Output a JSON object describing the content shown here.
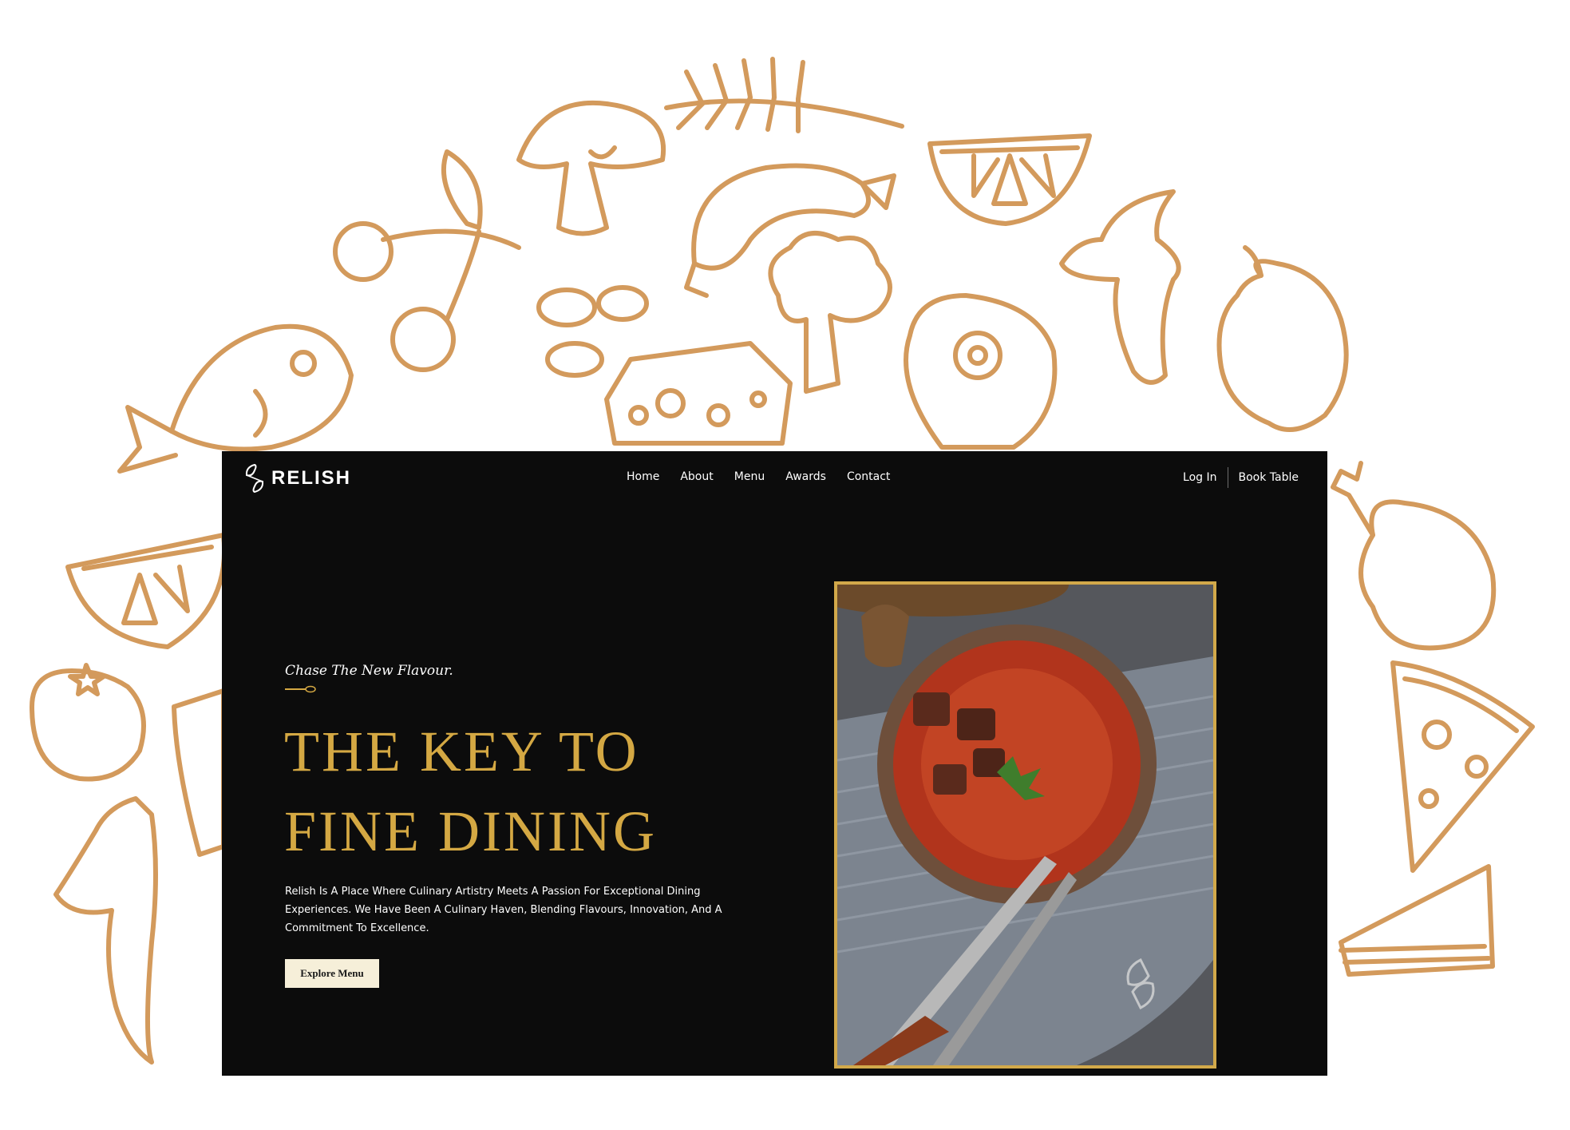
{
  "brand": {
    "name": "RELISH",
    "logo_icon": "relish-leaf-logo"
  },
  "nav": {
    "links": [
      "Home",
      "About",
      "Menu",
      "Awards",
      "Contact"
    ],
    "login": "Log In",
    "book_table": "Book Table"
  },
  "hero": {
    "tagline": "Chase The New Flavour.",
    "headline_line1": "THE KEY TO",
    "headline_line2": "FINE DINING",
    "description": "Relish Is A Place Where Culinary Artistry Meets A Passion For Exceptional Dining Experiences. We Have Been A Culinary Haven, Blending Flavours, Innovation, And A Commitment To Excellence.",
    "cta": "Explore Menu"
  },
  "colors": {
    "accent": "#d4a843",
    "doodle": "#d39a5c",
    "site_background": "#0c0c0c",
    "button_background": "#f6efd9"
  },
  "decor": {
    "background_icons": [
      "wheat-icon",
      "mushroom-icon",
      "sausage-icon",
      "orange-slice-icon",
      "cherry-icon",
      "banana-icon",
      "bell-pepper-icon",
      "fish-icon",
      "beans-icon",
      "broccoli-icon",
      "cheese-icon",
      "steak-icon",
      "chicken-leg-icon",
      "tomato-icon",
      "pizza-icon",
      "sandwich-icon"
    ],
    "dish_image": "tomato-beef-soup-bowl-with-fork-and-knife"
  }
}
